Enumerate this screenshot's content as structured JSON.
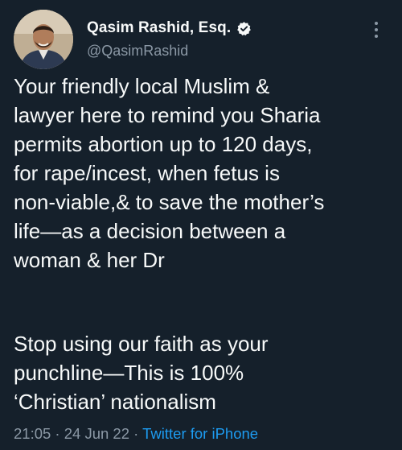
{
  "author": {
    "display_name": "Qasim Rashid, Esq.",
    "handle": "@QasimRashid",
    "verified": true
  },
  "tweet": {
    "paragraph1": [
      "Your friendly local Muslim &",
      "lawyer here to remind you Sharia",
      "permits abortion up to 120 days,",
      "for rape/incest, when fetus is",
      "non-viable,& to save the mother’s",
      "life—as a decision between a",
      "woman & her Dr"
    ],
    "paragraph2": [
      "Stop using our faith as your",
      "punchline—This is 100%",
      "‘Christian’ nationalism"
    ]
  },
  "meta": {
    "time": "21:05",
    "separator": " · ",
    "date": "24 Jun 22",
    "source": "Twitter for iPhone"
  },
  "colors": {
    "background": "#15202b",
    "text": "#f7f9f9",
    "secondary": "#8b98a5",
    "link": "#1d9bf0"
  },
  "icons": {
    "verified": "verified-badge-icon",
    "more": "more-options-icon"
  }
}
